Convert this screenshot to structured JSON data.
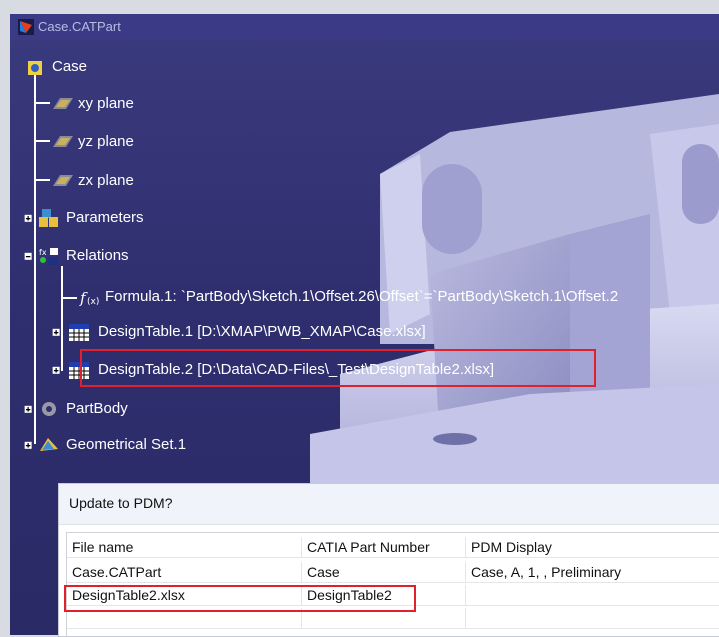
{
  "window": {
    "title": "Case.CATPart"
  },
  "tree": {
    "root": "Case",
    "xy_plane": "xy plane",
    "yz_plane": "yz plane",
    "zx_plane": "zx plane",
    "parameters": "Parameters",
    "relations": "Relations",
    "formula": "Formula.1: `PartBody\\Sketch.1\\Offset.26\\Offset`=`PartBody\\Sketch.1\\Offset.2",
    "design_table_1": "DesignTable.1 [D:\\XMAP\\PWB_XMAP\\Case.xlsx]",
    "design_table_2": "DesignTable.2 [D:\\Data\\CAD-Files\\_Test\\DesignTable2.xlsx]",
    "part_body": "PartBody",
    "geometrical_set": "Geometrical Set.1"
  },
  "dialog": {
    "title": "Update to PDM?",
    "columns": [
      "File name",
      "CATIA Part Number",
      "PDM Display"
    ],
    "rows": [
      [
        "Case.CATPart",
        "Case",
        "Case, A, 1, , Preliminary"
      ],
      [
        "DesignTable2.xlsx",
        "DesignTable2",
        ""
      ]
    ]
  },
  "colors": {
    "background": "#2f2f70",
    "highlight": "#e0202c",
    "tree_text": "#ffffff"
  }
}
